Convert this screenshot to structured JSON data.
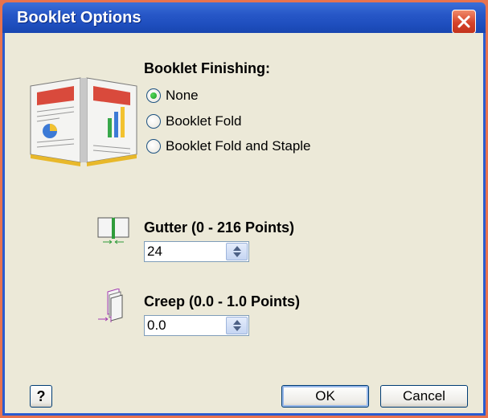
{
  "window": {
    "title": "Booklet Options"
  },
  "finishing": {
    "label": "Booklet Finishing:",
    "options": [
      {
        "label": "None",
        "checked": true
      },
      {
        "label": "Booklet Fold",
        "checked": false
      },
      {
        "label": "Booklet Fold and Staple",
        "checked": false
      }
    ]
  },
  "gutter": {
    "label": "Gutter (0 - 216 Points)",
    "value": "24"
  },
  "creep": {
    "label": "Creep (0.0 - 1.0 Points)",
    "value": "0.0"
  },
  "buttons": {
    "help": "?",
    "ok": "OK",
    "cancel": "Cancel"
  },
  "colors": {
    "titlebar": "#2757c7",
    "background": "#ece9d8",
    "close": "#d6432a"
  }
}
